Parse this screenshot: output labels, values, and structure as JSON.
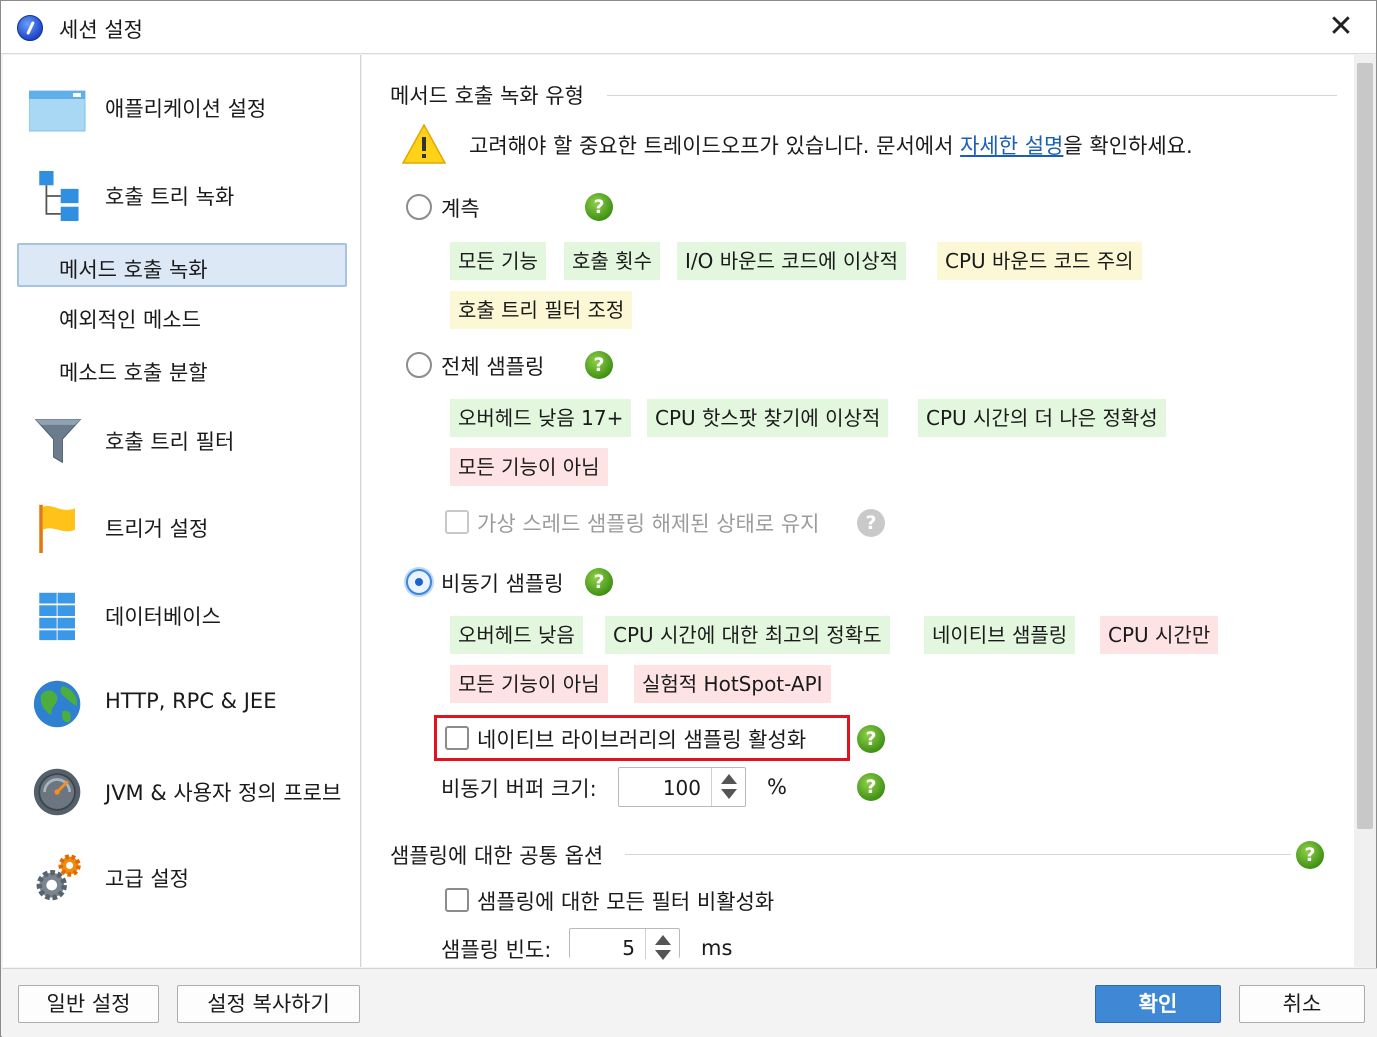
{
  "window": {
    "title": "세션 설정",
    "close": "✕"
  },
  "sidebar": {
    "items": [
      {
        "label": "애플리케이션 설정",
        "icon": "window-icon"
      },
      {
        "label": "호출 트리 녹화",
        "icon": "tree-icon"
      },
      {
        "label": "메서드 호출 녹화",
        "selected": true
      },
      {
        "label": "예외적인 메소드"
      },
      {
        "label": "메소드 호출 분할"
      },
      {
        "label": "호출 트리 필터",
        "icon": "funnel-icon"
      },
      {
        "label": "트리거 설정",
        "icon": "flag-icon"
      },
      {
        "label": "데이터베이스",
        "icon": "database-icon"
      },
      {
        "label": "HTTP, RPC & JEE",
        "icon": "globe-icon"
      },
      {
        "label": "JVM & 사용자 정의 프로브",
        "icon": "gauge-icon"
      },
      {
        "label": "고급 설정",
        "icon": "gears-icon"
      }
    ]
  },
  "main": {
    "section1": "메서드 호출 녹화 유형",
    "warning": {
      "before": "고려해야 할 중요한 트레이드오프가 있습니다. 문서에서 ",
      "link": "자세한 설명",
      "after": "을 확인하세요."
    },
    "instrumentation": {
      "label": "계측",
      "tags": [
        "모든 기능",
        "호출 횟수",
        "I/O 바운드 코드에 이상적",
        "CPU 바운드 코드 주의",
        "호출 트리 필터 조정"
      ]
    },
    "full_sampling": {
      "label": "전체 샘플링",
      "tags": [
        "오버헤드 낮음 17+",
        "CPU 핫스팟 찾기에 이상적",
        "CPU 시간의 더 나은 정확성",
        "모든 기능이 아님"
      ],
      "virtual_thread_checkbox": "가상 스레드 샘플링 해제된 상태로 유지"
    },
    "async_sampling": {
      "label": "비동기 샘플링",
      "tags": [
        "오버헤드 낮음",
        "CPU 시간에 대한 최고의 정확도",
        "네이티브 샘플링",
        "CPU 시간만",
        "모든 기능이 아님",
        "실험적 HotSpot-API"
      ],
      "native_checkbox": "네이티브 라이브러리의 샘플링 활성화",
      "buffer_label": "비동기 버퍼 크기:",
      "buffer_value": "100",
      "buffer_unit": "%"
    },
    "section2": "샘플링에 대한 공통 옵션",
    "disable_filters_checkbox": "샘플링에 대한 모든 필터 비활성화",
    "frequency_label": "샘플링 빈도:",
    "frequency_value": "5",
    "frequency_unit": "ms",
    "help_glyph": "?"
  },
  "footer": {
    "general_settings": "일반 설정",
    "copy_settings": "설정 복사하기",
    "ok": "확인",
    "cancel": "취소"
  },
  "colors": {
    "accent": "#3f88d6",
    "tag_green": "#e3f7de",
    "tag_yellow": "#fcf8d6",
    "tag_red": "#fde3e3",
    "highlight": "#e0141e"
  }
}
